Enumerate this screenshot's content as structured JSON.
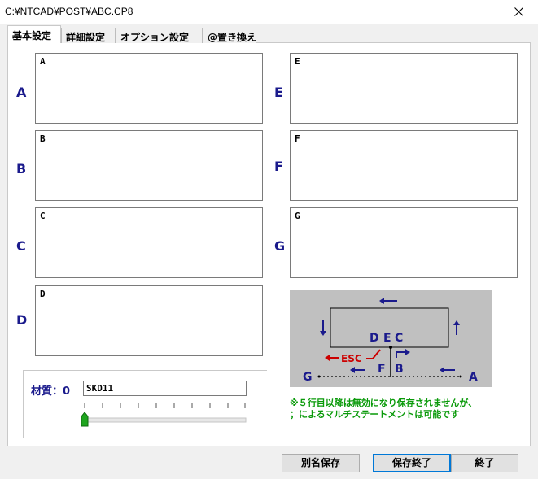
{
  "window": {
    "title": "C:¥NTCAD¥POST¥ABC.CP8"
  },
  "tabs": [
    {
      "label": "基本設定"
    },
    {
      "label": "詳細設定"
    },
    {
      "label": "オプション設定"
    },
    {
      "label": "@置き換え"
    }
  ],
  "fields": [
    {
      "row_label": "A",
      "value": "A"
    },
    {
      "row_label": "B",
      "value": "B"
    },
    {
      "row_label": "C",
      "value": "C"
    },
    {
      "row_label": "D",
      "value": "D"
    },
    {
      "row_label": "E",
      "value": "E"
    },
    {
      "row_label": "F",
      "value": "F"
    },
    {
      "row_label": "G",
      "value": "G"
    }
  ],
  "material": {
    "label": "材質：0",
    "value": "SKD11",
    "slider_value": 0
  },
  "diagram": {
    "labels": {
      "d": "D",
      "e": "E",
      "c": "C",
      "f": "F",
      "b": "B",
      "g": "G",
      "a": "A",
      "esc": "ESC"
    },
    "colors": {
      "background": "#c0c0c0",
      "arrow": "#1a1a8c",
      "esc": "#cc0000"
    }
  },
  "note": {
    "line1": "※５行目以降は無効になり保存されませんが、",
    "line2": "；によるマルチステートメントは可能です"
  },
  "buttons": {
    "save_as": "別名保存",
    "save_exit": "保存終了",
    "exit": "終了"
  }
}
